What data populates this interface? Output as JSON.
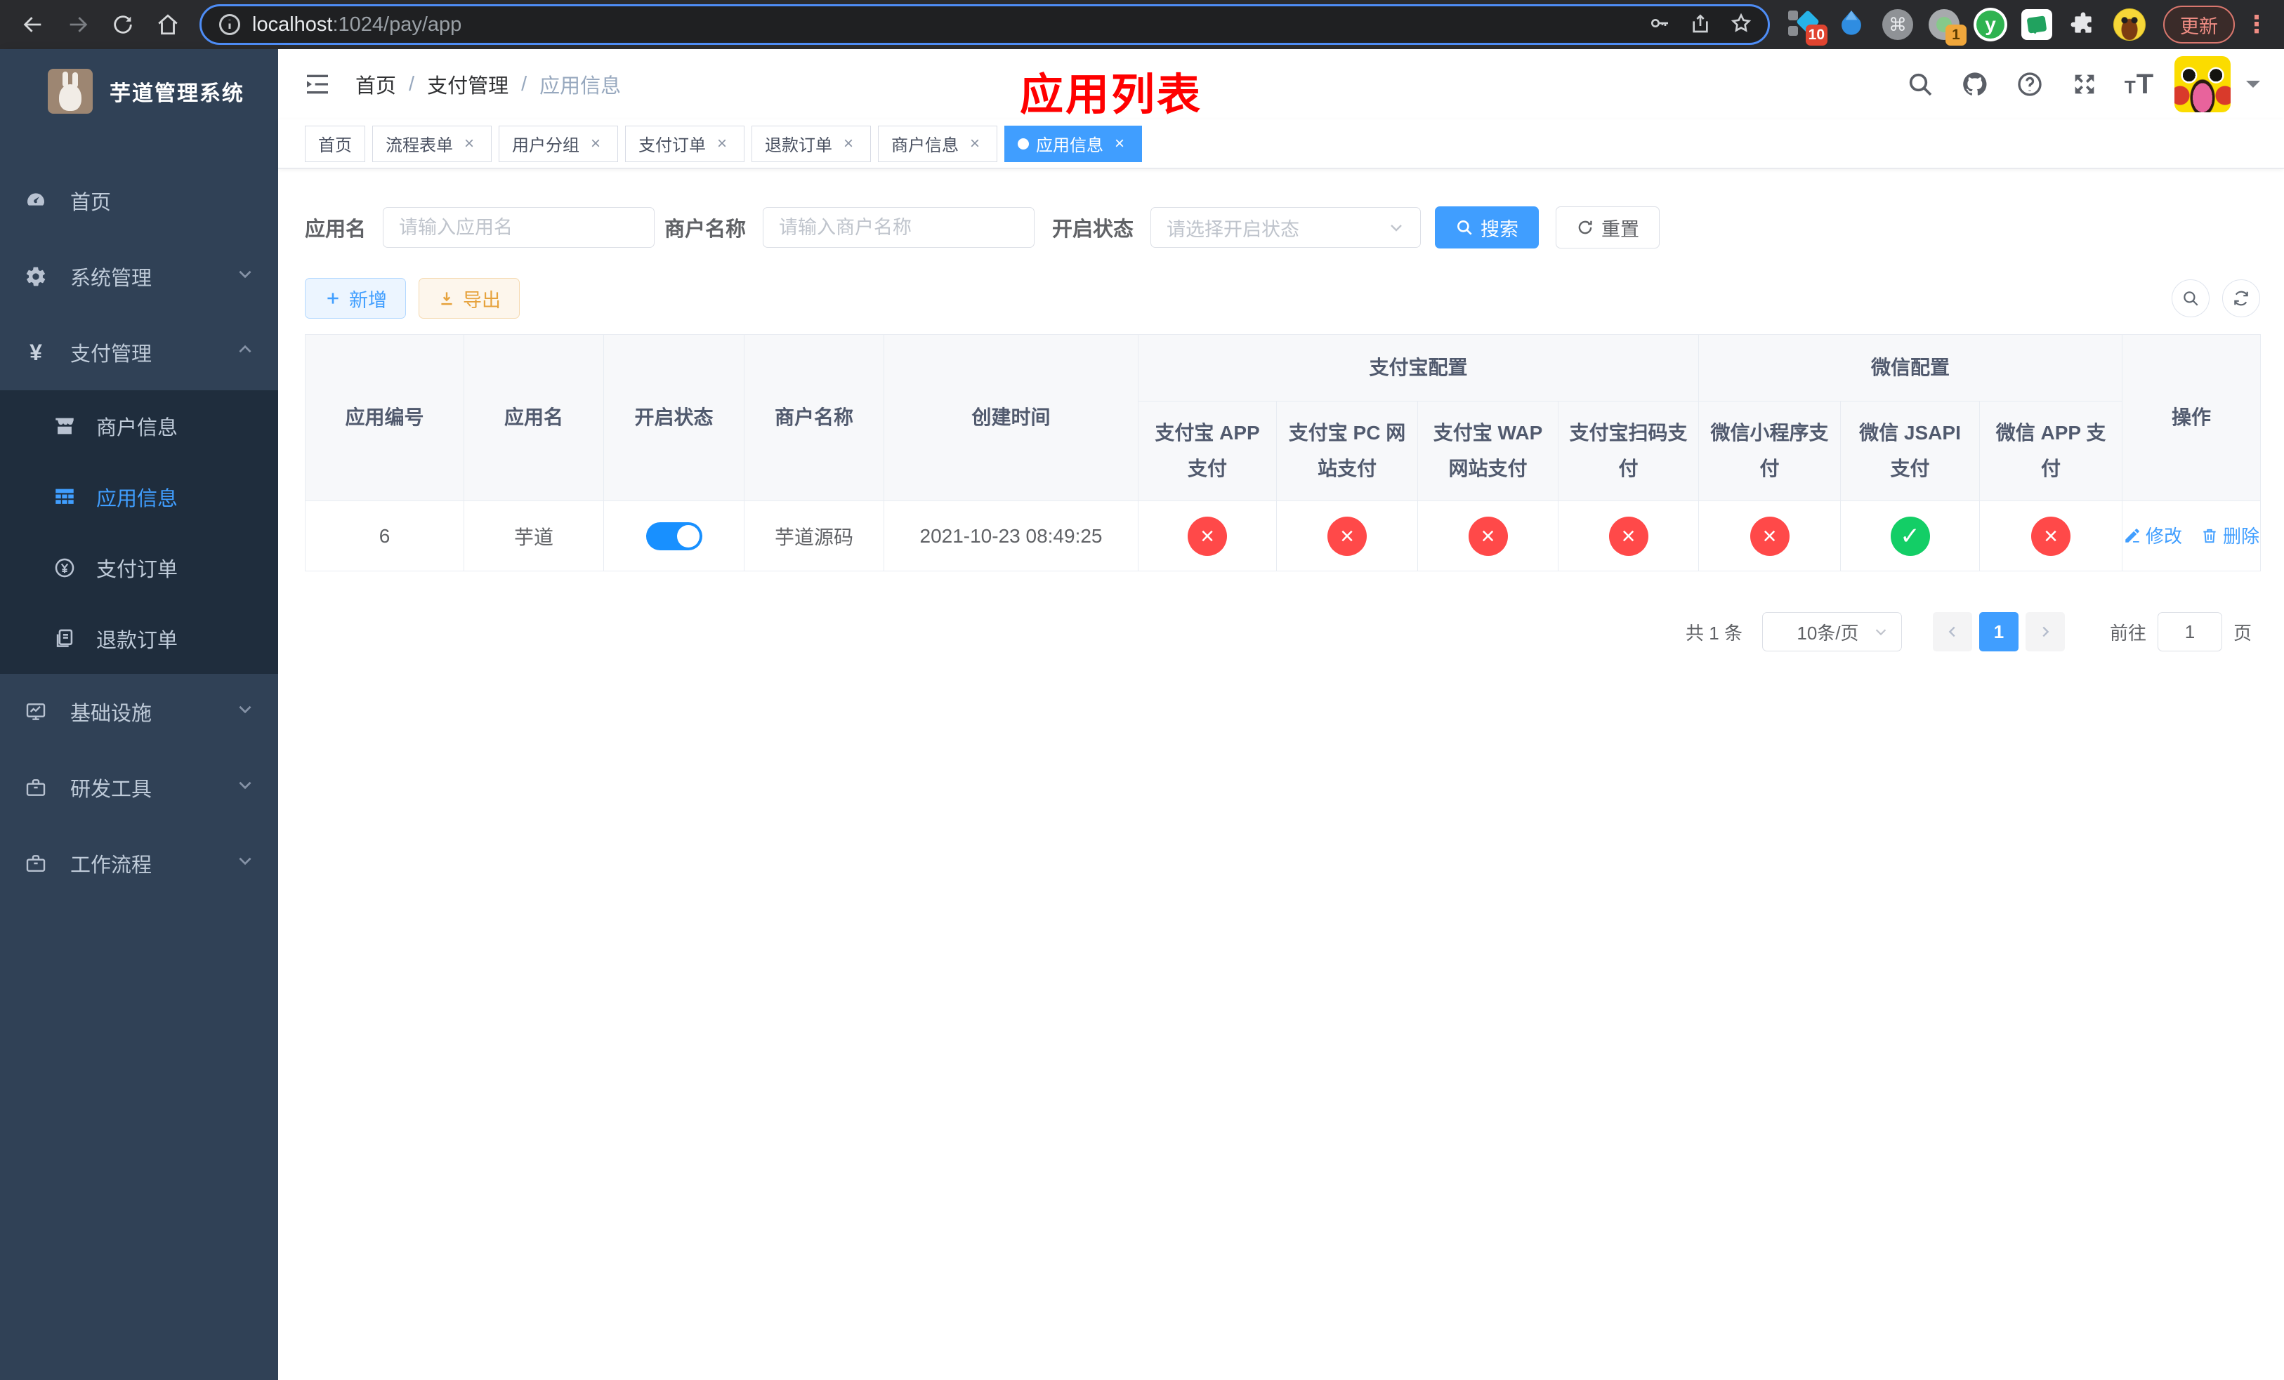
{
  "browser": {
    "url_host": "localhost",
    "url_path": ":1024/pay/app",
    "ext_badge_10": "10",
    "ext_badge_1": "1",
    "ext_y_letter": "y",
    "update_label": "更新",
    "kebab_glyph": "⋮",
    "command_glyph": "⌘"
  },
  "sidebar": {
    "title": "芋道管理系统",
    "items": [
      {
        "label": "首页"
      },
      {
        "label": "系统管理"
      },
      {
        "label": "支付管理"
      },
      {
        "label": "商户信息"
      },
      {
        "label": "应用信息"
      },
      {
        "label": "支付订单"
      },
      {
        "label": "退款订单"
      },
      {
        "label": "基础设施"
      },
      {
        "label": "研发工具"
      },
      {
        "label": "工作流程"
      }
    ]
  },
  "navbar": {
    "breadcrumb": {
      "home": "首页",
      "section": "支付管理",
      "current": "应用信息"
    },
    "separator": "/"
  },
  "annotation_title": "应用列表",
  "tags": [
    {
      "label": "首页"
    },
    {
      "label": "流程表单"
    },
    {
      "label": "用户分组"
    },
    {
      "label": "支付订单"
    },
    {
      "label": "退款订单"
    },
    {
      "label": "商户信息"
    },
    {
      "label": "应用信息"
    }
  ],
  "filters": {
    "app_name": {
      "label": "应用名",
      "placeholder": "请输入应用名",
      "value": ""
    },
    "merchant_name": {
      "label": "商户名称",
      "placeholder": "请输入商户名称",
      "value": ""
    },
    "status": {
      "label": "开启状态",
      "placeholder": "请选择开启状态",
      "value": ""
    },
    "search_label": "搜索",
    "reset_label": "重置"
  },
  "actions": {
    "add_label": "新增",
    "export_label": "导出"
  },
  "table": {
    "columns": [
      "应用编号",
      "应用名",
      "开启状态",
      "商户名称",
      "创建时间"
    ],
    "groups": {
      "alipay": "支付宝配置",
      "wechat": "微信配置"
    },
    "channel_columns": [
      "支付宝 APP 支付",
      "支付宝 PC 网站支付",
      "支付宝 WAP 网站支付",
      "支付宝扫码支付",
      "微信小程序支付",
      "微信 JSAPI 支付",
      "微信 APP 支付"
    ],
    "op_column": "操作",
    "rows": [
      {
        "id": "6",
        "name": "芋道",
        "enabled": true,
        "merchant": "芋道源码",
        "created_at": "2021-10-23 08:49:25",
        "channels": [
          "no",
          "no",
          "no",
          "no",
          "no",
          "yes",
          "no"
        ],
        "edit_label": "修改",
        "delete_label": "删除"
      }
    ]
  },
  "pagination": {
    "total": "共 1 条",
    "page_size": "10条/页",
    "current_page": "1",
    "goto_label": "前往",
    "goto_value": "1",
    "page_unit": "页"
  },
  "icons": {
    "close": "×",
    "check": "✓",
    "cross": "×",
    "yen": "¥",
    "big_t": "T",
    "small_t": "T"
  },
  "colors": {
    "primary": "#409eff",
    "success": "#13ce66",
    "danger": "#ff4949",
    "warning": "#e6a23c",
    "sidebar_bg": "#304156",
    "submenu_bg": "#1f2d3d",
    "annotation": "#ff0000"
  }
}
